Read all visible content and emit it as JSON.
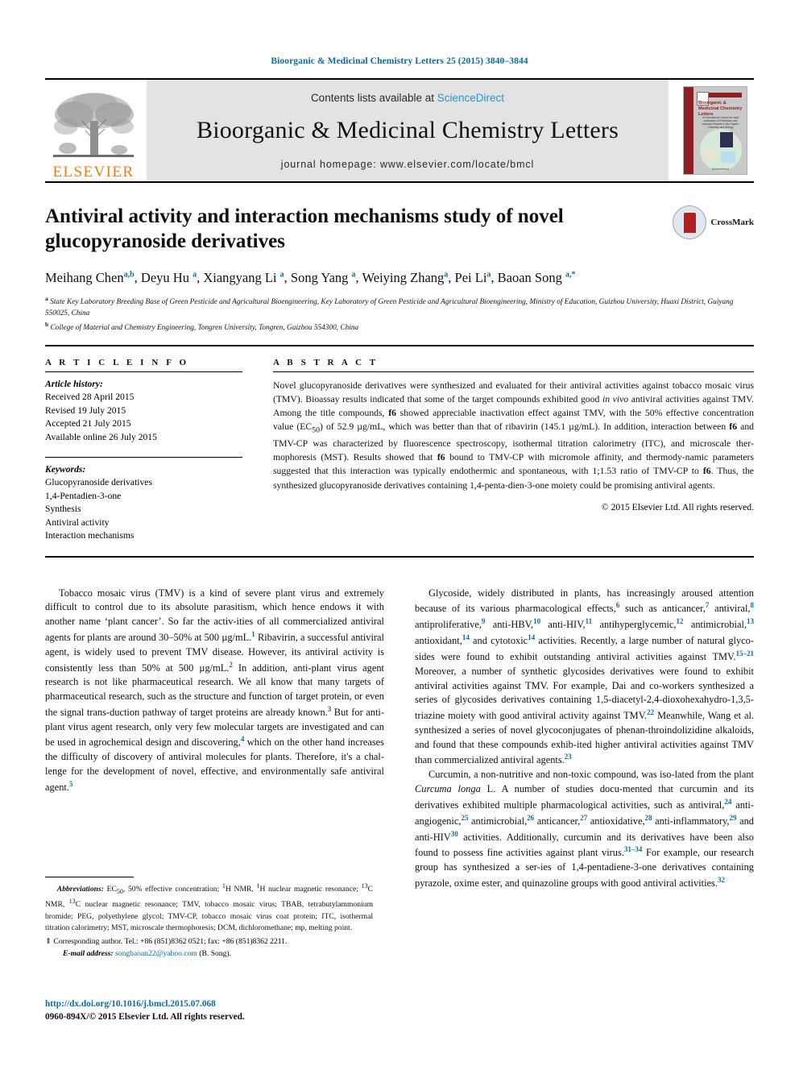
{
  "running_head": "Bioorganic & Medicinal Chemistry Letters 25 (2015) 3840–3844",
  "masthead": {
    "elsevier_wordmark": "ELSEVIER",
    "contents_prefix": "Contents lists available at ",
    "sciencedirect": "ScienceDirect",
    "journal_name": "Bioorganic & Medicinal Chemistry Letters",
    "homepage": "journal homepage: www.elsevier.com/locate/bmcl",
    "cover": {
      "title": "Bioorganic & Medicinal Chemistry Letters",
      "subtitle": "An Internatonal Journal for rapid publication of Preliminary and Important Results in Bio-Organic Chemistry and Biology",
      "editors": "List Kodiwara Adams",
      "footer": "ScienceDirect"
    }
  },
  "article": {
    "title": "Antiviral activity and interaction mechanisms study of novel glucopyranoside derivatives",
    "crossmark_label": "CrossMark",
    "authors_html": "Meihang Chen<sup>a,b</sup>, Deyu Hu <sup>a</sup>, Xiangyang Li <sup>a</sup>, Song Yang <sup>a</sup>, Weiying Zhang<sup>a</sup>, Pei Li<sup>a</sup>, Baoan Song <sup>a,</sup><sup>*</sup>",
    "affiliation_a": "State Key Laboratory Breeding Base of Green Pesticide and Agricultural Bioengineering, Key Laboratory of Green Pesticide and Agricultural Bioengineering, Ministry of Education, Guizhou University, Huaxi District, Guiyang 550025, China",
    "affiliation_b": "College of Material and Chemistry Engineering, Tongren University, Tongren, Guizhou 554300, China"
  },
  "sections": {
    "article_info_heading": "A R T I C L E   I N F O",
    "abstract_heading": "A B S T R A C T"
  },
  "article_history": {
    "label": "Article history:",
    "lines": [
      "Received 28 April 2015",
      "Revised 19 July 2015",
      "Accepted 21 July 2015",
      "Available online 26 July 2015"
    ]
  },
  "keywords": {
    "label": "Keywords:",
    "items": [
      "Glucopyranoside derivatives",
      "1,4-Pentadien-3-one",
      "Synthesis",
      "Antiviral activity",
      "Interaction mechanisms"
    ]
  },
  "abstract": {
    "text": "Novel glucopyranoside derivatives were synthesized and evaluated for their antiviral activities against tobacco mosaic virus (TMV). Bioassay results indicated that some of the target compounds exhibited good in vivo antiviral activities against TMV. Among the title compounds, f6 showed appreciable inactivation effect against TMV, with the 50% effective concentration value (EC50) of 52.9 µg/mL, which was better than that of ribavirin (145.1 µg/mL). In addition, interaction between f6 and TMV-CP was characterized by fluorescence spectroscopy, isothermal titration calorimetry (ITC), and microscale thermophoresis (MST). Results showed that f6 bound to TMV-CP with micromole affinity, and thermodynamic parameters suggested that this interaction was typically endothermic and spontaneous, with 1;1.53 ratio of TMV-CP to f6. Thus, the synthesized glucopyranoside derivatives containing 1,4-pentadien-3-one moiety could be promising antiviral agents.",
    "copyright": "© 2015 Elsevier Ltd. All rights reserved."
  },
  "body": {
    "left_paragraph_1": "Tobacco mosaic virus (TMV) is a kind of severe plant virus and extremely difficult to control due to its absolute parasitism, which hence endows it with another name ‘plant cancer’. So far the activities of all commercialized antiviral agents for plants are around 30–50% at 500 µg/mL.1 Ribavirin, a successful antiviral agent, is widely used to prevent TMV disease. However, its antiviral activity is consistently less than 50% at 500 µg/mL.2 In addition, anti-plant virus agent research is not like pharmaceutical research. We all know that many targets of pharmaceutical research, such as the structure and function of target protein, or even the signal transduction pathway of target proteins are already known.3 But for anti-plant virus agent research, only very few molecular targets are investigated and can be used in agrochemical design and discovering,4 which on the other hand increases the difficulty of discovery of antiviral molecules for plants. Therefore, it's a challenge for the development of novel, effective, and environmentally safe antiviral agent.5",
    "right_paragraph_1": "Glycoside, widely distributed in plants, has increasingly aroused attention because of its various pharmacological effects,6 such as anticancer,7 antiviral,8 antiproliferative,9 anti-HBV,10 anti-HIV,11 antihyperglycemic,12 antimicrobial,13 antioxidant,14 and cytotoxic14 activities. Recently, a large number of natural glycosides were found to exhibit outstanding antiviral activities against TMV.15–21 Moreover, a number of synthetic glycosides derivatives were found to exhibit antiviral activities against TMV. For example, Dai and co-workers synthesized a series of glycosides derivatives containing 1,5-diacetyl-2,4-dioxohexahydro-1,3,5-triazine moiety with good antiviral activity against TMV.22 Meanwhile, Wang et al. synthesized a series of novel glycoconjugates of phenanthroindolizidine alkaloids, and found that these compounds exhibited higher antiviral activities against TMV than commercialized antiviral agents.23",
    "right_paragraph_2": "Curcumin, a non-nutritive and non-toxic compound, was isolated from the plant Curcuma longa L. A number of studies documented that curcumin and its derivatives exhibited multiple pharmacological activities, such as antiviral,24 anti-angiogenic,25 antimicrobial,26 anticancer,27 antioxidative,28 anti-inflammatory,29 and anti-HIV30 activities. Additionally, curcumin and its derivatives have been also found to possess fine activities against plant virus.31–34 For example, our research group has synthesized a series of 1,4-pentadiene-3-one derivatives containing pyrazole, oxime ester, and quinazoline groups with good antiviral activities.32"
  },
  "footnotes": {
    "abbreviations_label": "Abbreviations:",
    "abbreviations_text": "EC50, 50% effective concentration; 1H NMR, 1H nuclear magnetic resonance; 13C NMR, 13C nuclear magnetic resonance; TMV, tobacco mosaic virus; TBAB, tetrabutylammonium bromide; PEG, polyethylene glycol; TMV-CP, tobacco mosaic virus coat protein; ITC, isothermal titration calorimetry; MST, microscale thermophoresis; DCM, dichloromethane; mp, melting point.",
    "corresponding": "⇑ Corresponding author. Tel.: +86 (851)8362 0521; fax: +86 (851)8362 2211.",
    "email_label": "E-mail address:",
    "email": "songbaoan22@yahoo.com",
    "email_suffix": " (B. Song)."
  },
  "footer": {
    "doi": "http://dx.doi.org/10.1016/j.bmcl.2015.07.068",
    "issn": "0960-894X/© 2015 Elsevier Ltd. All rights reserved."
  },
  "colors": {
    "link_blue": "#0c6ca0",
    "sciencedirect_blue": "#2a93d1",
    "elsevier_orange": "#f07f13",
    "cover_red": "#8d2025"
  }
}
